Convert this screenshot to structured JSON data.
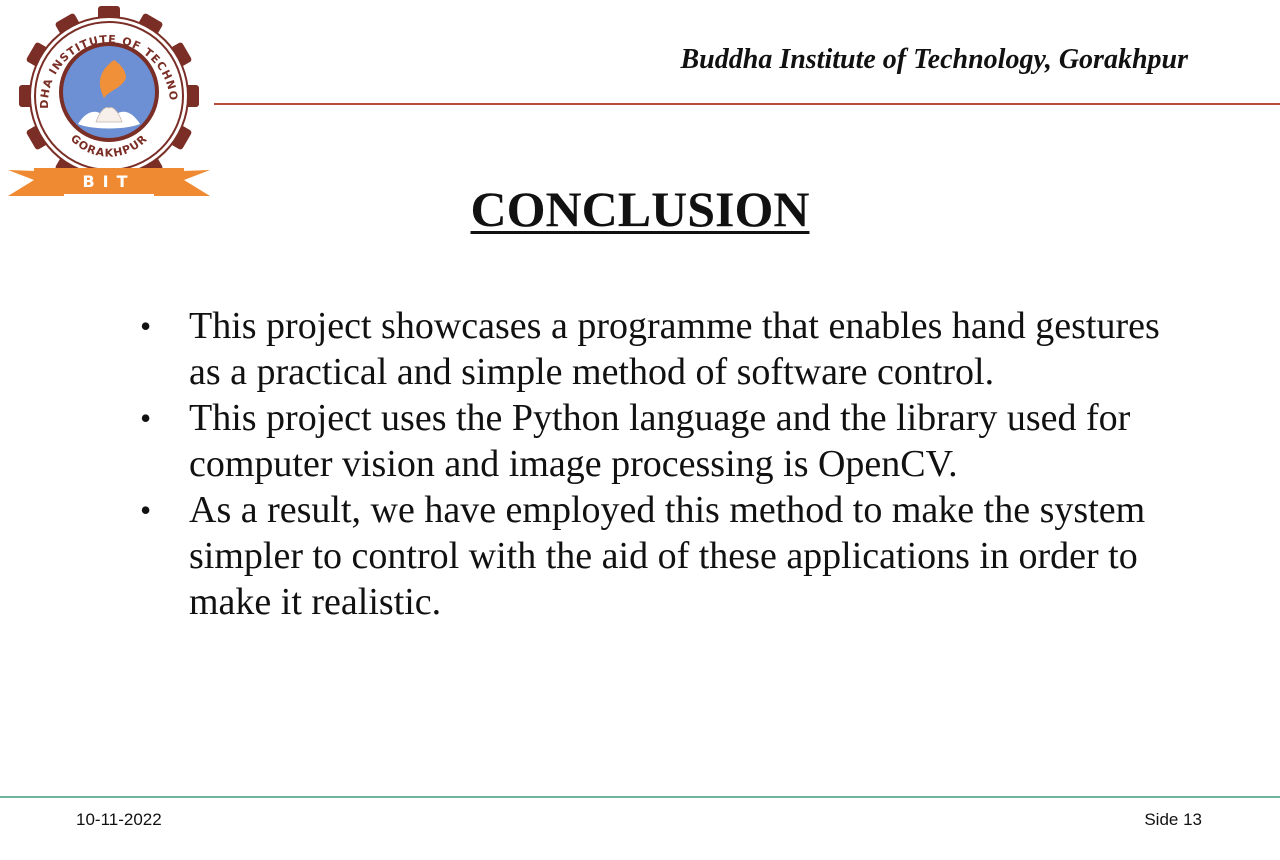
{
  "header": {
    "institute_name": "Buddha Institute of Technology, Gorakhpur",
    "logo": {
      "icon": "college-seal-logo",
      "ring_text": "BUDDHA INSTITUTE OF TECHNOLOGY",
      "city_text": "GORAKHPUR",
      "banner_text": "BIT",
      "colors": {
        "ring": "#7a2e26",
        "inner": "#6d8fd3",
        "flame": "#f0913a",
        "banner": "#f08a32"
      }
    }
  },
  "slide": {
    "title": "CONCLUSION",
    "bullets": [
      "This project showcases a programme that enables hand gestures as a practical and simple method of software control.",
      "This project uses the Python language and the library used for computer vision and image processing is OpenCV.",
      "As a result, we have employed this method to make the system simpler to control with the aid of these applications in order to make it realistic."
    ]
  },
  "footer": {
    "date": "10-11-2022",
    "slide_number": "Side 13"
  },
  "colors": {
    "header_rule": "#b84a3e",
    "footer_rule": "#6fb59c"
  }
}
